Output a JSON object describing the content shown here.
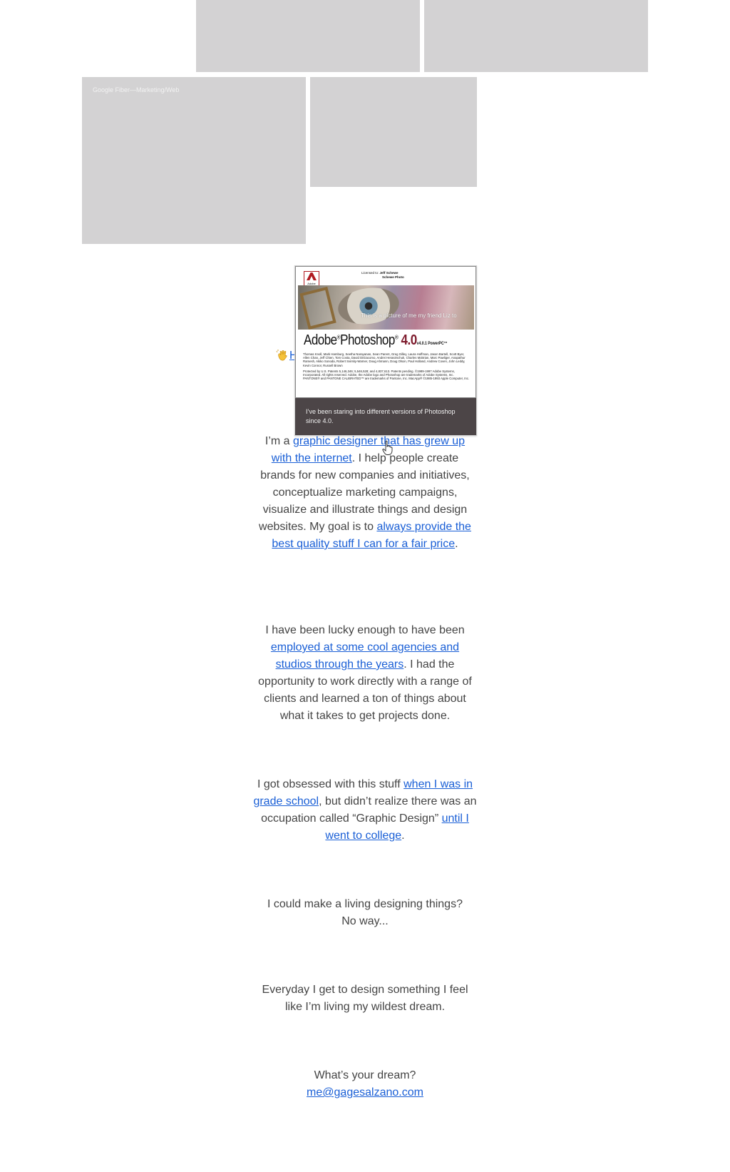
{
  "tiles": {
    "gf_caption": "Google Fiber—Marketing/Web"
  },
  "intro": {
    "greeting_fragment": "H",
    "p1": {
      "pre": "I’m a ",
      "link1": "graphic designer that has grew up with the internet",
      "mid": ". I help people create brands for new companies and initiatives, conceptualize marketing campaigns, visualize and illustrate things and design websites. My goal is to ",
      "link2": "always provide the best quality stuff I can for a fair price",
      "post": "."
    }
  },
  "popup": {
    "licensed_to": "Licensed to:",
    "licensee_name": "Jeff Schewe",
    "licensee_org": "Schewe Photo",
    "logo_text": "Adobe",
    "title_pre": "Adobe",
    "title_reg": "®",
    "title_main": "Photoshop",
    "title_reg2": "®",
    "title_version": " 4.0",
    "title_sub": "v4.0.1 PowerPC™",
    "overlay_text": "This is a picture of me my friend Liz to",
    "credits_1": "Thomas Knoll, Mark Hamburg, Seetha Narayanan, Sean Parent, Greg Gilley, Laura Hoffman, Jason Bartell, Scott Byer, Allen Chan, Jeff Chien, Tom Costa, David DiGiacomo, Andrei Herasimchuk, Charles McBrian, Marc Pawliger, Anapathur Ramesh, Akiko Sonoda, Robert Svirsky-Warner, Doug Ahmann, Doug Olson, Paul Holland, Andrew Coven, John Leddy, Kevin Connor, Russell Brown",
    "credits_2": "Protected by U.S. Patents 5,146,346; 5,546,528; and 4,837,613. Patents pending. ©1989-1997 Adobe Systems, Incorporated. All rights reserved. Adobe, the Adobe logo and Photoshop are trademarks of Adobe Systems, Inc. PANTONE® and PANTONE CALIBRATED™ are trademarks of Pantone, Inc. MacApp® ©1985-1993 Apple Computer, Inc.",
    "caption": "I’ve been staring into different versions of Photoshop since 4.0."
  },
  "p2": {
    "pre": "I have been lucky enough to have been ",
    "link": "employed at some cool agencies and studios through the years",
    "post": ". I had the opportunity to work directly with a range of clients and learned a ton of things about what it takes to get projects done."
  },
  "p3": {
    "pre": "I got obsessed with this stuff ",
    "link1": "when I was in grade school",
    "mid": ", but didn’t realize there was an occupation called “Graphic Design” ",
    "link2": "until I went to college",
    "post": "."
  },
  "p4": {
    "line1": "I could make a living designing things?",
    "line2": "No way..."
  },
  "p5": {
    "text": "Everyday I get to design something I feel like I’m living my wildest dream."
  },
  "p6": {
    "question": "What’s your dream?",
    "email": "me@gagesalzano.com"
  },
  "colors": {
    "link": "#1a5fd6",
    "tile": "#d3d2d3",
    "caption_bg": "#4c4547",
    "text": "#444444"
  },
  "icons": [
    "waving-hand-icon",
    "pointer-hand-cursor-icon",
    "adobe-logo-icon"
  ]
}
